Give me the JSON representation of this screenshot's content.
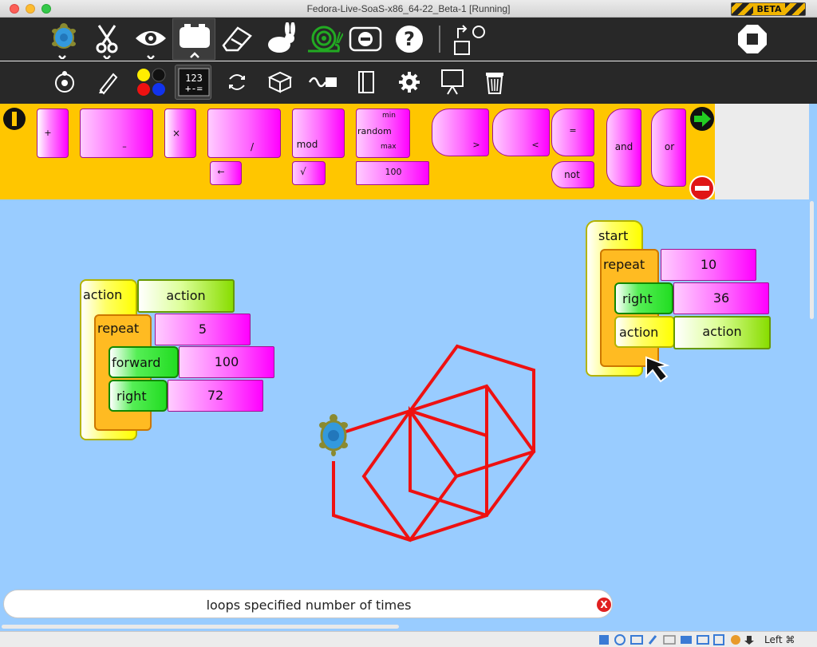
{
  "window": {
    "title": "Fedora-Live-SoaS-x86_64-22_Beta-1 [Running]",
    "beta_badge": "BETA"
  },
  "toolbar_main": [
    "turtle-menu",
    "edit-cut",
    "view-eye",
    "palette-toggle",
    "eraser",
    "run-fast",
    "run-slow",
    "step",
    "help",
    "load-plugin",
    "stop"
  ],
  "toolbar_palettes": [
    "turtle",
    "pen",
    "colors",
    "numbers",
    "flow",
    "boxes",
    "sensors",
    "media",
    "settings",
    "presentation",
    "trash"
  ],
  "palette": {
    "numbers_blocks": {
      "plus": "+",
      "minus": "–",
      "times": "×",
      "divide": "/",
      "mod": "mod",
      "random": "random",
      "random_min": "min",
      "random_max": "max",
      "greater": ">",
      "less": "<",
      "equal": "=",
      "and": "and",
      "or": "or",
      "not": "not",
      "identity": "←",
      "sqrt": "√",
      "number_value": "100"
    }
  },
  "canvas": {
    "action_stack": {
      "action_label": "action",
      "action_name": "action",
      "repeat_label": "repeat",
      "repeat_value": "5",
      "forward_label": "forward",
      "forward_value": "100",
      "right_label": "right",
      "right_value": "72"
    },
    "start_stack": {
      "start_label": "start",
      "repeat_label": "repeat",
      "repeat_value": "10",
      "right_label": "right",
      "right_value": "36",
      "action_label": "action",
      "action_name": "action"
    }
  },
  "help": {
    "text": "loops specified number of times",
    "close_label": "X"
  },
  "statusbar": {
    "host_key": "Left ⌘"
  },
  "colors": {
    "canvas": "#99ccff",
    "toolbar": "#282828",
    "palette": "#ffc600",
    "pen": "#ee1111"
  }
}
